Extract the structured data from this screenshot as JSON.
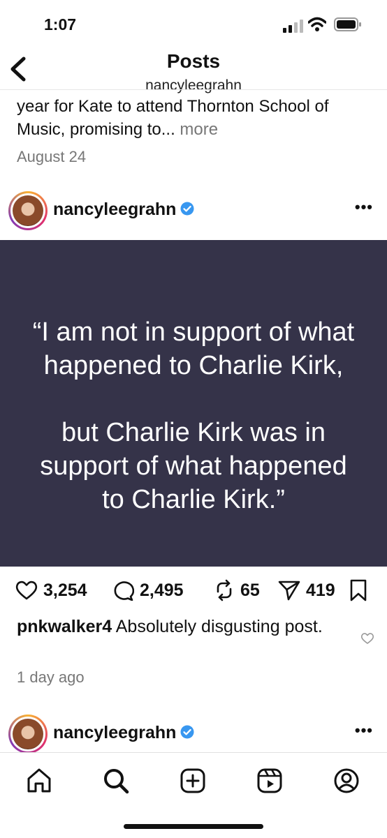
{
  "status_bar": {
    "time": "1:07"
  },
  "nav": {
    "title": "Posts",
    "subtitle": "nancyleegrahn"
  },
  "previous_post": {
    "caption_text": "year for Kate to attend Thornton School of Music, promising to...",
    "more_label": "more",
    "date": "August 24"
  },
  "post": {
    "username": "nancyleegrahn",
    "menu": "•••",
    "quote_line1": "“I am not in support of what",
    "quote_line2": "happened to Charlie Kirk,",
    "quote_line3": "but Charlie Kirk was in",
    "quote_line4": "support of what happened",
    "quote_line5": "to Charlie Kirk.”",
    "likes": "3,254",
    "comments": "2,495",
    "reposts": "65",
    "shares": "419",
    "top_comment": {
      "user": "pnkwalker4",
      "text": " Absolutely disgusting post."
    },
    "time_ago": "1 day ago"
  },
  "next_post": {
    "username": "nancyleegrahn",
    "menu": "•••"
  },
  "colors": {
    "quote_bg": "#353349",
    "verified": "#3897f0"
  }
}
